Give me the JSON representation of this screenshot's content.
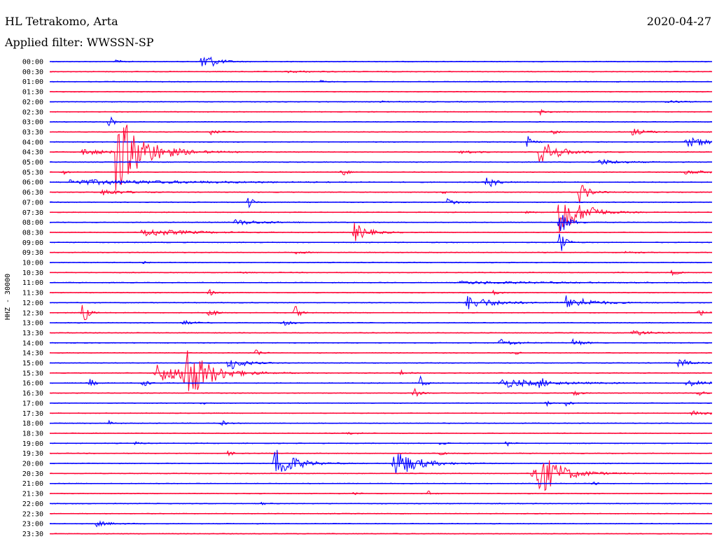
{
  "header": {
    "station": "HL Tetrakomo, Arta",
    "date": "2020-04-27",
    "filter": "Applied filter: WWSSN-SP"
  },
  "chart_data": {
    "type": "helicorder",
    "channel_label": "HHZ - 30000",
    "colors": [
      "#0000ff",
      "#ff0033"
    ],
    "rows": [
      {
        "label": "00:00",
        "events": [
          {
            "at": 0.23,
            "amp": 18,
            "dur": 0.025
          },
          {
            "at": 0.1,
            "amp": 2,
            "dur": 0.02
          }
        ]
      },
      {
        "label": "00:30",
        "events": [
          {
            "at": 0.36,
            "amp": 1.5,
            "dur": 0.05
          }
        ]
      },
      {
        "label": "01:00",
        "events": [
          {
            "at": 0.41,
            "amp": 2,
            "dur": 0.01
          }
        ]
      },
      {
        "label": "01:30",
        "events": []
      },
      {
        "label": "02:00",
        "events": [
          {
            "at": 0.5,
            "amp": 2,
            "dur": 0.02
          },
          {
            "at": 0.93,
            "amp": 2,
            "dur": 0.03
          }
        ]
      },
      {
        "label": "02:30",
        "events": [
          {
            "at": 0.74,
            "amp": 5,
            "dur": 0.01
          }
        ]
      },
      {
        "label": "03:00",
        "events": [
          {
            "at": 0.09,
            "amp": 10,
            "dur": 0.01
          }
        ]
      },
      {
        "label": "03:30",
        "events": [
          {
            "at": 0.24,
            "amp": 5,
            "dur": 0.02
          },
          {
            "at": 0.76,
            "amp": 4,
            "dur": 0.01
          },
          {
            "at": 0.88,
            "amp": 5,
            "dur": 0.03
          }
        ]
      },
      {
        "label": "04:00",
        "events": [
          {
            "at": 0.72,
            "amp": 12,
            "dur": 0.01
          },
          {
            "at": 0.96,
            "amp": 7,
            "dur": 0.07
          }
        ]
      },
      {
        "label": "04:30",
        "events": [
          {
            "at": 0.05,
            "amp": 5,
            "dur": 0.05
          },
          {
            "at": 0.1,
            "amp": 60,
            "dur": 0.06
          },
          {
            "at": 0.74,
            "amp": 20,
            "dur": 0.04
          },
          {
            "at": 0.62,
            "amp": 3,
            "dur": 0.03
          }
        ]
      },
      {
        "label": "05:00",
        "events": [
          {
            "at": 0.83,
            "amp": 4,
            "dur": 0.05
          }
        ]
      },
      {
        "label": "05:30",
        "events": [
          {
            "at": 0.44,
            "amp": 10,
            "dur": 0.01
          },
          {
            "at": 0.02,
            "amp": 4,
            "dur": 0.01
          },
          {
            "at": 0.96,
            "amp": 3,
            "dur": 0.05
          }
        ]
      },
      {
        "label": "06:00",
        "events": [
          {
            "at": 0.66,
            "amp": 10,
            "dur": 0.02
          },
          {
            "at": 0.03,
            "amp": 4,
            "dur": 0.25
          }
        ]
      },
      {
        "label": "06:30",
        "events": [
          {
            "at": 0.8,
            "amp": 16,
            "dur": 0.02
          },
          {
            "at": 0.08,
            "amp": 5,
            "dur": 0.04
          },
          {
            "at": 0.59,
            "amp": 5,
            "dur": 0.01
          }
        ]
      },
      {
        "label": "07:00",
        "events": [
          {
            "at": 0.3,
            "amp": 10,
            "dur": 0.01
          },
          {
            "at": 0.6,
            "amp": 6,
            "dur": 0.02
          }
        ]
      },
      {
        "label": "07:30",
        "events": [
          {
            "at": 0.77,
            "amp": 40,
            "dur": 0.04
          },
          {
            "at": 0.72,
            "amp": 4,
            "dur": 0.01
          },
          {
            "at": 0.82,
            "amp": 8,
            "dur": 0.01
          }
        ]
      },
      {
        "label": "08:00",
        "events": [
          {
            "at": 0.77,
            "amp": 18,
            "dur": 0.02
          },
          {
            "at": 0.28,
            "amp": 4,
            "dur": 0.06
          }
        ]
      },
      {
        "label": "08:30",
        "events": [
          {
            "at": 0.46,
            "amp": 14,
            "dur": 0.03
          },
          {
            "at": 0.14,
            "amp": 6,
            "dur": 0.09
          }
        ]
      },
      {
        "label": "09:00",
        "events": [
          {
            "at": 0.77,
            "amp": 30,
            "dur": 0.01
          }
        ]
      },
      {
        "label": "09:30",
        "events": [
          {
            "at": 0.37,
            "amp": 2,
            "dur": 0.02
          },
          {
            "at": 0.87,
            "amp": 2,
            "dur": 0.02
          }
        ]
      },
      {
        "label": "10:00",
        "events": [
          {
            "at": 0.14,
            "amp": 3,
            "dur": 0.01
          }
        ]
      },
      {
        "label": "10:30",
        "events": [
          {
            "at": 0.94,
            "amp": 5,
            "dur": 0.01
          },
          {
            "at": 0.29,
            "amp": 2,
            "dur": 0.01
          }
        ]
      },
      {
        "label": "11:00",
        "events": [
          {
            "at": 0.62,
            "amp": 2,
            "dur": 0.2
          }
        ]
      },
      {
        "label": "11:30",
        "events": [
          {
            "at": 0.24,
            "amp": 6,
            "dur": 0.01
          },
          {
            "at": 0.67,
            "amp": 5,
            "dur": 0.01
          }
        ]
      },
      {
        "label": "12:00",
        "events": [
          {
            "at": 0.63,
            "amp": 10,
            "dur": 0.06
          },
          {
            "at": 0.78,
            "amp": 12,
            "dur": 0.01
          },
          {
            "at": 0.79,
            "amp": 8,
            "dur": 0.05
          }
        ]
      },
      {
        "label": "12:30",
        "events": [
          {
            "at": 0.05,
            "amp": 22,
            "dur": 0.01
          },
          {
            "at": 0.24,
            "amp": 14,
            "dur": 0.01
          },
          {
            "at": 0.37,
            "amp": 14,
            "dur": 0.01
          },
          {
            "at": 0.98,
            "amp": 8,
            "dur": 0.01
          }
        ]
      },
      {
        "label": "13:00",
        "events": [
          {
            "at": 0.35,
            "amp": 5,
            "dur": 0.02
          },
          {
            "at": 0.2,
            "amp": 4,
            "dur": 0.02
          }
        ]
      },
      {
        "label": "13:30",
        "events": [
          {
            "at": 0.88,
            "amp": 5,
            "dur": 0.03
          }
        ]
      },
      {
        "label": "14:00",
        "events": [
          {
            "at": 0.68,
            "amp": 6,
            "dur": 0.03
          },
          {
            "at": 0.79,
            "amp": 6,
            "dur": 0.02
          }
        ]
      },
      {
        "label": "14:30",
        "events": [
          {
            "at": 0.31,
            "amp": 8,
            "dur": 0.01
          },
          {
            "at": 0.7,
            "amp": 4,
            "dur": 0.01
          }
        ]
      },
      {
        "label": "15:00",
        "events": [
          {
            "at": 0.27,
            "amp": 12,
            "dur": 0.03
          },
          {
            "at": 0.95,
            "amp": 8,
            "dur": 0.02
          }
        ]
      },
      {
        "label": "15:30",
        "events": [
          {
            "at": 0.2,
            "amp": 45,
            "dur": 0.05
          },
          {
            "at": 0.16,
            "amp": 14,
            "dur": 0.08
          },
          {
            "at": 0.53,
            "amp": 4,
            "dur": 0.01
          }
        ]
      },
      {
        "label": "16:00",
        "events": [
          {
            "at": 0.06,
            "amp": 8,
            "dur": 0.01
          },
          {
            "at": 0.14,
            "amp": 8,
            "dur": 0.01
          },
          {
            "at": 0.56,
            "amp": 10,
            "dur": 0.01
          },
          {
            "at": 0.74,
            "amp": 8,
            "dur": 0.01
          },
          {
            "at": 0.68,
            "amp": 7,
            "dur": 0.1
          },
          {
            "at": 0.96,
            "amp": 5,
            "dur": 0.04
          }
        ]
      },
      {
        "label": "16:30",
        "events": [
          {
            "at": 0.55,
            "amp": 8,
            "dur": 0.01
          },
          {
            "at": 0.79,
            "amp": 8,
            "dur": 0.01
          },
          {
            "at": 0.98,
            "amp": 6,
            "dur": 0.01
          }
        ]
      },
      {
        "label": "17:00",
        "events": [
          {
            "at": 0.23,
            "amp": 4,
            "dur": 0.01
          },
          {
            "at": 0.75,
            "amp": 4,
            "dur": 0.01
          },
          {
            "at": 0.78,
            "amp": 4,
            "dur": 0.01
          }
        ]
      },
      {
        "label": "17:30",
        "events": [
          {
            "at": 0.97,
            "amp": 3,
            "dur": 0.04
          }
        ]
      },
      {
        "label": "18:00",
        "events": [
          {
            "at": 0.09,
            "amp": 4,
            "dur": 0.01
          },
          {
            "at": 0.26,
            "amp": 4,
            "dur": 0.01
          }
        ]
      },
      {
        "label": "18:30",
        "events": [
          {
            "at": 0.45,
            "amp": 2,
            "dur": 0.02
          }
        ]
      },
      {
        "label": "19:00",
        "events": [
          {
            "at": 0.59,
            "amp": 4,
            "dur": 0.01
          },
          {
            "at": 0.69,
            "amp": 5,
            "dur": 0.01
          },
          {
            "at": 0.13,
            "amp": 3,
            "dur": 0.01
          }
        ]
      },
      {
        "label": "19:30",
        "events": [
          {
            "at": 0.27,
            "amp": 4,
            "dur": 0.01
          },
          {
            "at": 0.59,
            "amp": 3,
            "dur": 0.01
          }
        ]
      },
      {
        "label": "20:00",
        "events": [
          {
            "at": 0.34,
            "amp": 28,
            "dur": 0.04
          },
          {
            "at": 0.52,
            "amp": 22,
            "dur": 0.05
          }
        ]
      },
      {
        "label": "20:30",
        "events": [
          {
            "at": 0.73,
            "amp": 44,
            "dur": 0.05
          }
        ]
      },
      {
        "label": "21:00",
        "events": [
          {
            "at": 0.82,
            "amp": 3,
            "dur": 0.01
          }
        ]
      },
      {
        "label": "21:30",
        "events": [
          {
            "at": 0.57,
            "amp": 5,
            "dur": 0.01
          },
          {
            "at": 0.46,
            "amp": 2,
            "dur": 0.01
          }
        ]
      },
      {
        "label": "22:00",
        "events": [
          {
            "at": 0.32,
            "amp": 2,
            "dur": 0.01
          }
        ]
      },
      {
        "label": "22:30",
        "events": []
      },
      {
        "label": "23:00",
        "events": [
          {
            "at": 0.07,
            "amp": 4,
            "dur": 0.03
          }
        ]
      },
      {
        "label": "23:30",
        "events": []
      }
    ]
  }
}
